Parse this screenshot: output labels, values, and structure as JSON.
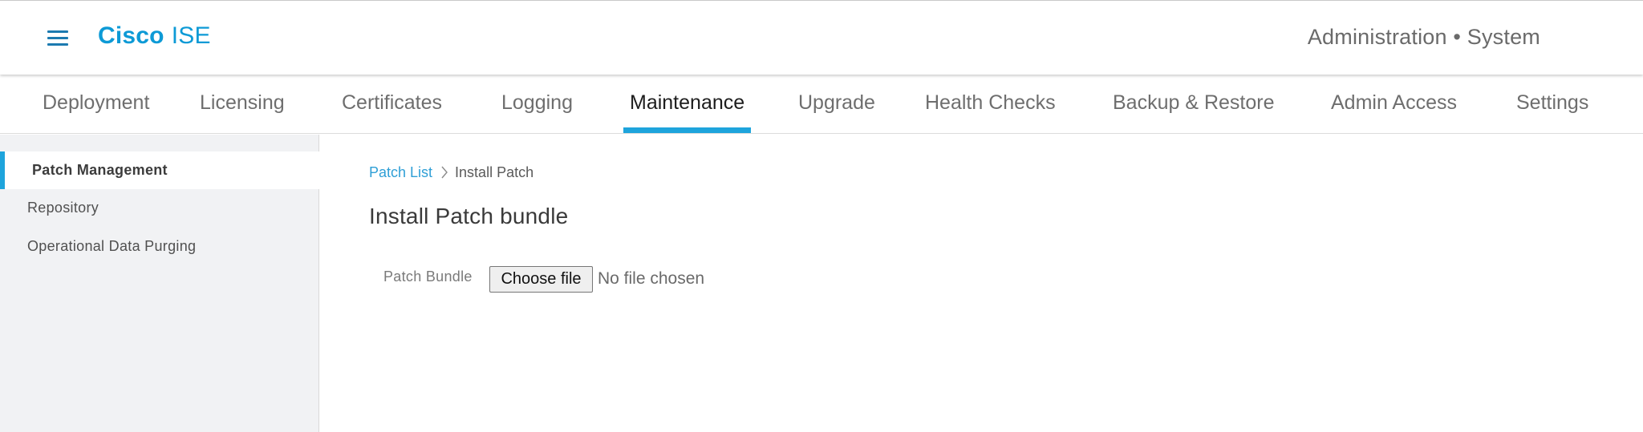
{
  "header": {
    "brand_bold": "Cisco",
    "brand_light": "ISE",
    "context": "Administration • System"
  },
  "tabs": [
    {
      "label": "Deployment",
      "active": false
    },
    {
      "label": "Licensing",
      "active": false
    },
    {
      "label": "Certificates",
      "active": false
    },
    {
      "label": "Logging",
      "active": false
    },
    {
      "label": "Maintenance",
      "active": true
    },
    {
      "label": "Upgrade",
      "active": false
    },
    {
      "label": "Health Checks",
      "active": false
    },
    {
      "label": "Backup & Restore",
      "active": false
    },
    {
      "label": "Admin Access",
      "active": false
    },
    {
      "label": "Settings",
      "active": false
    }
  ],
  "sidebar": {
    "items": [
      {
        "label": "Patch Management",
        "active": true
      },
      {
        "label": "Repository",
        "active": false
      },
      {
        "label": "Operational Data Purging",
        "active": false
      }
    ]
  },
  "breadcrumb": {
    "parent": "Patch List",
    "current": "Install Patch"
  },
  "page": {
    "title": "Install Patch bundle",
    "field_label": "Patch Bundle",
    "file_button": "Choose file",
    "file_status": "No file chosen"
  },
  "colors": {
    "accent": "#1ea4dc",
    "brand": "#0d9ad6",
    "link": "#2f9fd6"
  }
}
